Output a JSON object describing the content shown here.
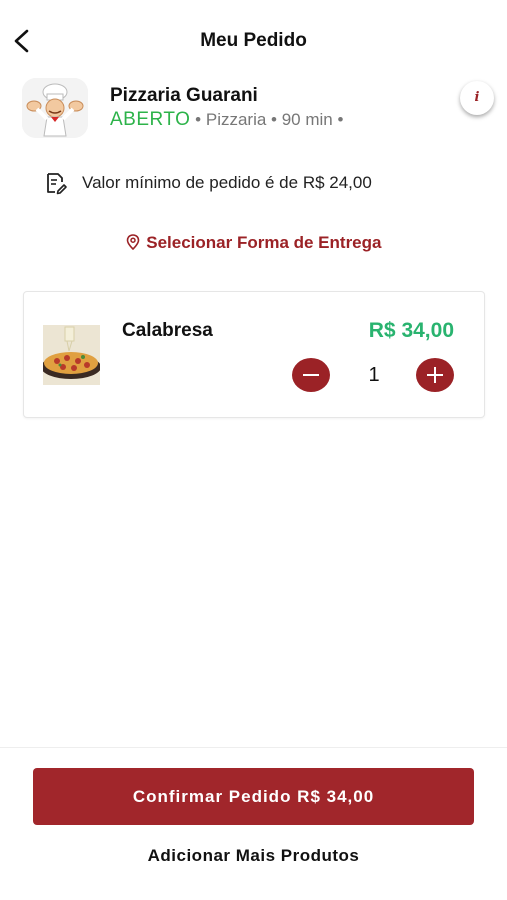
{
  "header": {
    "title": "Meu Pedido",
    "back_icon": "chevron-left-icon"
  },
  "store": {
    "name": "Pizzaria Guarani",
    "status": "ABERTO",
    "meta": " • Pizzaria • 90 min •",
    "logo_icon": "chef-logo-icon",
    "info_icon": "info-icon",
    "info_glyph": "i"
  },
  "min_order": {
    "icon": "document-edit-icon",
    "text": "Valor mínimo de pedido é de R$ 24,00"
  },
  "delivery": {
    "icon": "map-pin-icon",
    "label": "Selecionar Forma de Entrega"
  },
  "cart": {
    "items": [
      {
        "name": "Calabresa",
        "price": "R$ 34,00",
        "quantity": "1"
      }
    ]
  },
  "footer": {
    "confirm_label": "Confirmar Pedido R$ 34,00",
    "add_more_label": "Adicionar Mais Produtos"
  },
  "colors": {
    "brand": "#a1262b",
    "open_status": "#2db34a",
    "price": "#29b36f"
  }
}
